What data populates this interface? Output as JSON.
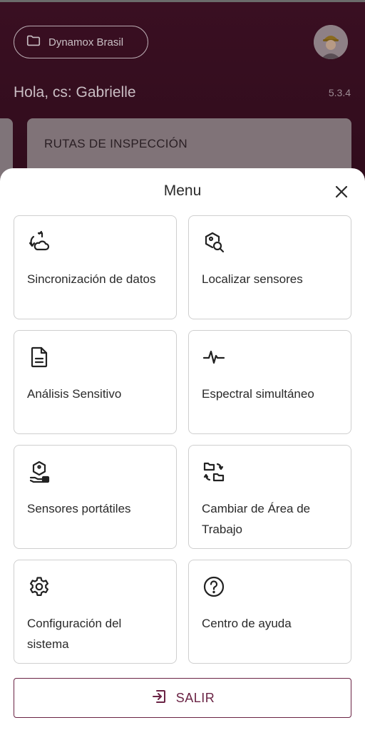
{
  "background": {
    "workspace_chip": {
      "label": "Dynamox Brasil",
      "icon": "folder-icon"
    },
    "greeting": "Hola, cs: Gabrielle",
    "version": "5.3.4",
    "card_title": "RUTAS DE INSPECCIÓN"
  },
  "menu": {
    "title": "Menu",
    "close_icon": "close-icon",
    "items": [
      {
        "label": "Sincronización de datos",
        "icon": "sync-cloud-icon"
      },
      {
        "label": "Localizar sensores",
        "icon": "locate-sensor-icon"
      },
      {
        "label": "Análisis Sensitivo",
        "icon": "document-icon"
      },
      {
        "label": "Espectral simultáneo",
        "icon": "waveform-icon"
      },
      {
        "label": "Sensores portátiles",
        "icon": "handheld-sensor-icon"
      },
      {
        "label": "Cambiar de Área de Trabajo",
        "icon": "swap-workspace-icon"
      },
      {
        "label": "Configuración del sistema",
        "icon": "gear-icon"
      },
      {
        "label": "Centro de ayuda",
        "icon": "help-icon"
      }
    ],
    "logout_label": "SALIR",
    "logout_icon": "logout-icon"
  },
  "colors": {
    "brand": "#6a2344",
    "header_bg": "#3a0f22"
  }
}
